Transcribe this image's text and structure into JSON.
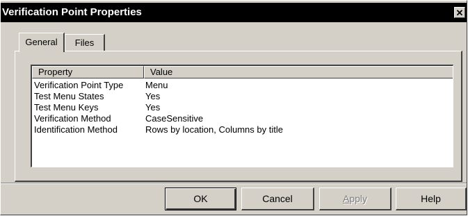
{
  "window": {
    "title": "Verification Point Properties",
    "close_glyph": "✕"
  },
  "tabs": [
    {
      "label": "General",
      "selected": true
    },
    {
      "label": "Files",
      "selected": false
    }
  ],
  "list": {
    "columns": [
      "Property",
      "Value"
    ],
    "rows": [
      {
        "property": "Verification Point Type",
        "value": "Menu"
      },
      {
        "property": "Test Menu States",
        "value": "Yes"
      },
      {
        "property": "Test Menu Keys",
        "value": "Yes"
      },
      {
        "property": "Verification Method",
        "value": "CaseSensitive"
      },
      {
        "property": "Identification Method",
        "value": "Rows by location, Columns by title"
      }
    ]
  },
  "buttons": {
    "ok": "OK",
    "cancel": "Cancel",
    "apply_first": "A",
    "apply_rest": "pply",
    "help": "Help"
  },
  "colors": {
    "face": "#d4d0c8",
    "titlebar": "#000000",
    "shadow": "#404040",
    "highlight": "#ffffff",
    "disabled_text": "#808080"
  },
  "icons": {
    "close": "close-icon"
  }
}
